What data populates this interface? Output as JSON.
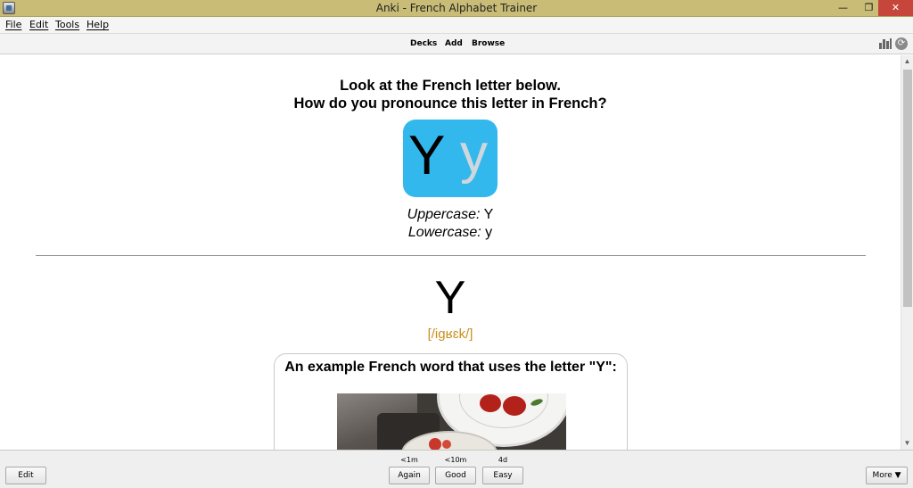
{
  "window": {
    "title": "Anki - French Alphabet Trainer",
    "controls": {
      "minimize": "—",
      "maximize": "❐",
      "close": "✕"
    }
  },
  "menu": {
    "items": [
      "File",
      "Edit",
      "Tools",
      "Help"
    ]
  },
  "toolbar": {
    "links": [
      "Decks",
      "Add",
      "Browse"
    ],
    "icons": [
      "stats-icon",
      "sync-icon"
    ]
  },
  "card": {
    "question_line1": "Look at the French letter below.",
    "question_line2": "How do you pronounce this letter in French?",
    "letter_upper": "Y",
    "letter_lower": "y",
    "letter_card_color": "#33b8ed",
    "uppercase_label": "Uppercase:",
    "uppercase_value": "Y",
    "lowercase_label": "Lowercase:",
    "lowercase_value": "y",
    "answer_letter": "Y",
    "pronunciation": "[/igʁɛk/]",
    "pronunciation_color": "#c98f1a",
    "example_heading": "An example French word that uses the letter \"Y\":"
  },
  "bottom": {
    "edit_label": "Edit",
    "more_label": "More ▼",
    "answers": [
      {
        "label": "Again",
        "interval": "<1m"
      },
      {
        "label": "Good",
        "interval": "<10m"
      },
      {
        "label": "Easy",
        "interval": "4d"
      }
    ]
  }
}
